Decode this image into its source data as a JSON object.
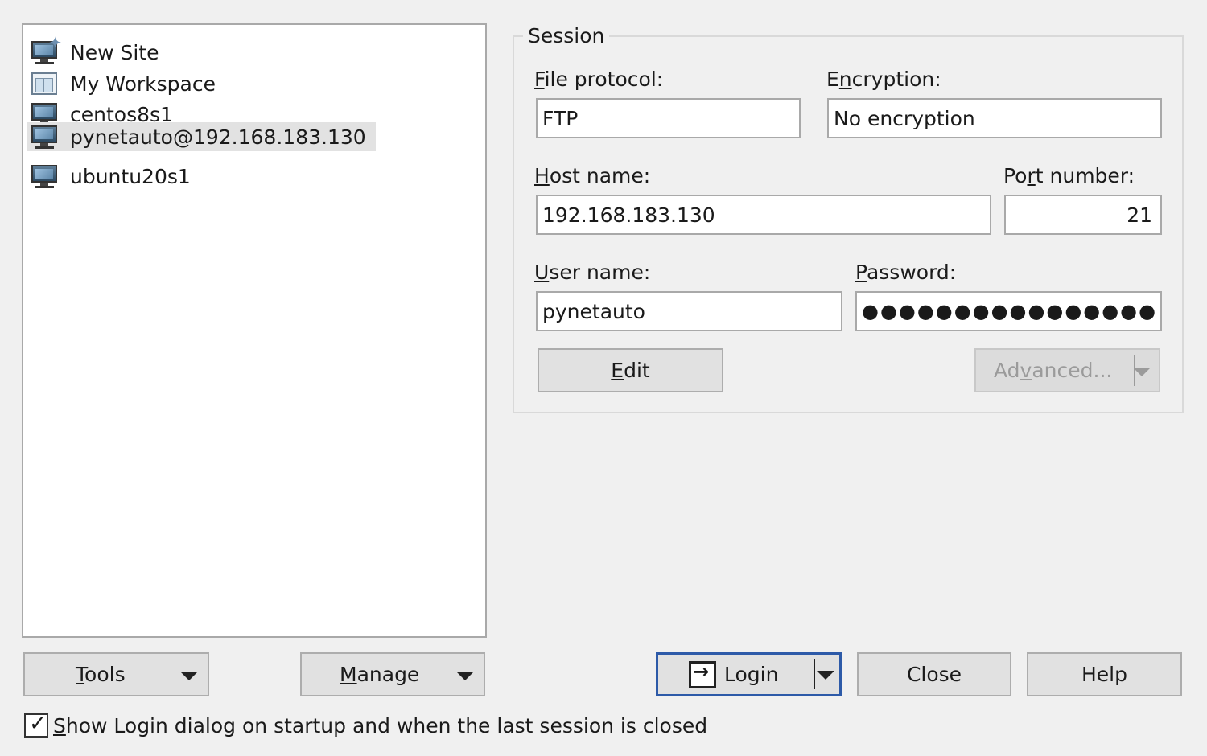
{
  "sites": [
    {
      "label": "New Site",
      "icon": "new-site-icon"
    },
    {
      "label": "My Workspace",
      "icon": "workspace-icon"
    },
    {
      "label": "centos8s1",
      "icon": "computer-icon"
    },
    {
      "label": "pynetauto@192.168.183.130",
      "icon": "computer-icon",
      "selected": true
    },
    {
      "label": "ubuntu20s1",
      "icon": "computer-icon"
    }
  ],
  "session": {
    "title": "Session",
    "file_protocol_label_first": "F",
    "file_protocol_label_rest": "ile protocol:",
    "file_protocol_value": "FTP",
    "encryption_label_pre": "E",
    "encryption_label_u": "n",
    "encryption_label_rest": "cryption:",
    "encryption_value": "No encryption",
    "host_label_first": "H",
    "host_label_rest": "ost name:",
    "host_value": "192.168.183.130",
    "port_label_pre": "Po",
    "port_label_u": "r",
    "port_label_rest": "t number:",
    "port_value": "21",
    "user_label_first": "U",
    "user_label_rest": "ser name:",
    "user_value": "pynetauto",
    "password_label_first": "P",
    "password_label_rest": "assword:",
    "password_value": "●●●●●●●●●●●●●●●●",
    "edit_first": "E",
    "edit_rest": "dit",
    "advanced_pre": "Ad",
    "advanced_u": "v",
    "advanced_rest": "anced..."
  },
  "buttons": {
    "tools_first": "T",
    "tools_rest": "ools",
    "manage_first": "M",
    "manage_rest": "anage",
    "login": "Login",
    "close": "Close",
    "help": "Help"
  },
  "startup_checkbox": {
    "label_first": "S",
    "label_rest": "how Login dialog on startup and when the last session is closed",
    "checked": true
  }
}
